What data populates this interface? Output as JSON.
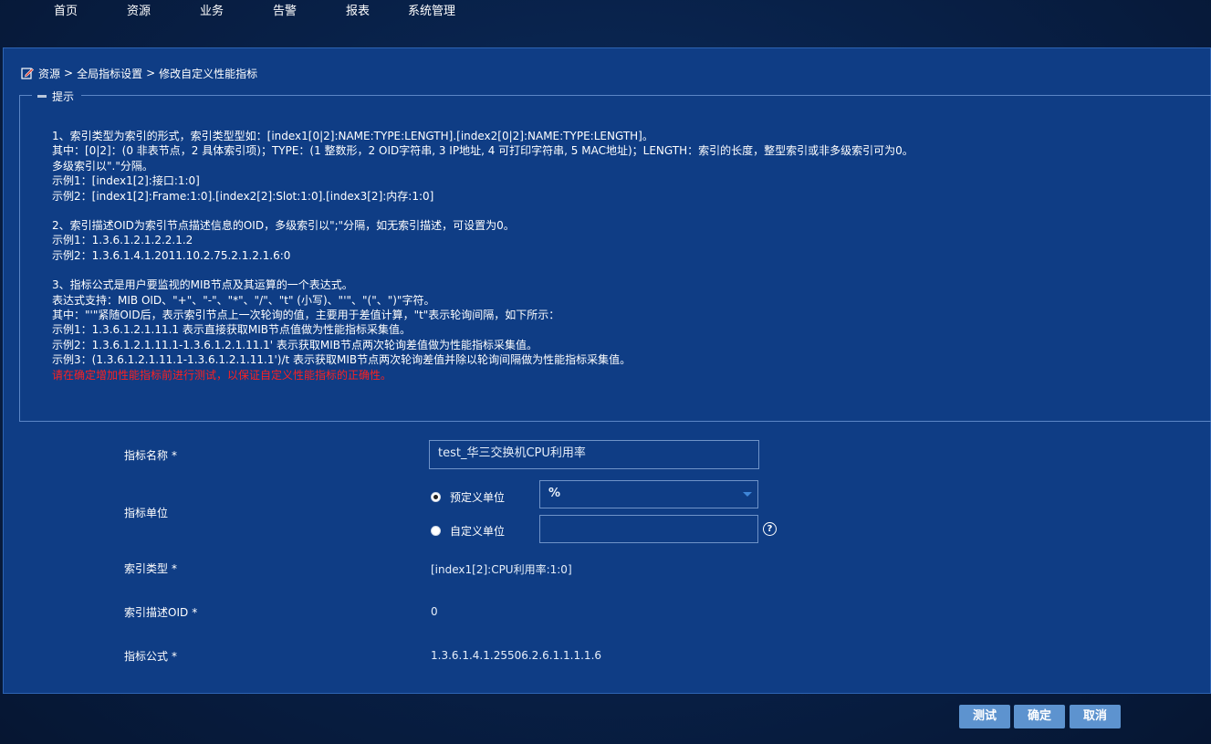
{
  "nav": {
    "items": [
      "首页",
      "资源",
      "业务",
      "告警",
      "报表",
      "系统管理"
    ]
  },
  "breadcrumb": {
    "items": [
      "资源",
      "全局指标设置",
      "修改自定义性能指标"
    ],
    "separator": ">"
  },
  "hint": {
    "title": "提示",
    "lines": [
      "1、索引类型为索引的形式，索引类型型如：[index1[0|2]:NAME:TYPE:LENGTH].[index2[0|2]:NAME:TYPE:LENGTH]。",
      "其中：[0|2]：(0 非表节点，2 具体索引项)；TYPE：(1 整数形，2 OID字符串, 3 IP地址, 4 可打印字符串, 5 MAC地址)；LENGTH：索引的长度，整型索引或非多级索引可为0。",
      "多级索引以\".\"分隔。",
      "示例1：[index1[2]:接口:1:0]",
      "示例2：[index1[2]:Frame:1:0].[index2[2]:Slot:1:0].[index3[2]:内存:1:0]",
      "2、索引描述OID为索引节点描述信息的OID，多级索引以\";\"分隔，如无索引描述，可设置为0。",
      "示例1：1.3.6.1.2.1.2.2.1.2",
      "示例2：1.3.6.1.4.1.2011.10.2.75.2.1.2.1.6:0",
      "3、指标公式是用户要监视的MIB节点及其运算的一个表达式。",
      "表达式支持：MIB OID、\"+\"、\"-\"、\"*\"、\"/\"、\"t\" (小写)、\"'\"、\"(\"、\")\"字符。",
      "其中：\"'\"紧随OID后，表示索引节点上一次轮询的值，主要用于差值计算，\"t\"表示轮询间隔，如下所示：",
      "示例1：1.3.6.1.2.1.11.1 表示直接获取MIB节点值做为性能指标采集值。",
      "示例2：1.3.6.1.2.1.11.1-1.3.6.1.2.1.11.1' 表示获取MIB节点两次轮询差值做为性能指标采集值。",
      "示例3：(1.3.6.1.2.1.11.1-1.3.6.1.2.1.11.1')/t 表示获取MIB节点两次轮询差值并除以轮询间隔做为性能指标采集值。"
    ],
    "warning": "请在确定增加性能指标前进行测试，以保证自定义性能指标的正确性。"
  },
  "form": {
    "required_mark": "*",
    "name_label": "指标名称",
    "name_value": "test_华三交换机CPU利用率",
    "unit_label": "指标单位",
    "unit_predefined_label": "预定义单位",
    "unit_predefined_value": "%",
    "unit_custom_label": "自定义单位",
    "unit_custom_value": "",
    "help_glyph": "?",
    "index_type_label": "索引类型",
    "index_type_value": "[index1[2]:CPU利用率:1:0]",
    "index_oid_label": "索引描述OID",
    "index_oid_value": "0",
    "formula_label": "指标公式",
    "formula_value": "1.3.6.1.4.1.25506.2.6.1.1.1.1.6"
  },
  "buttons": {
    "test": "测试",
    "ok": "确定",
    "cancel": "取消"
  },
  "colors": {
    "panel": "#0f3d85",
    "warning": "#ff2020",
    "button": "#5d93cf"
  }
}
